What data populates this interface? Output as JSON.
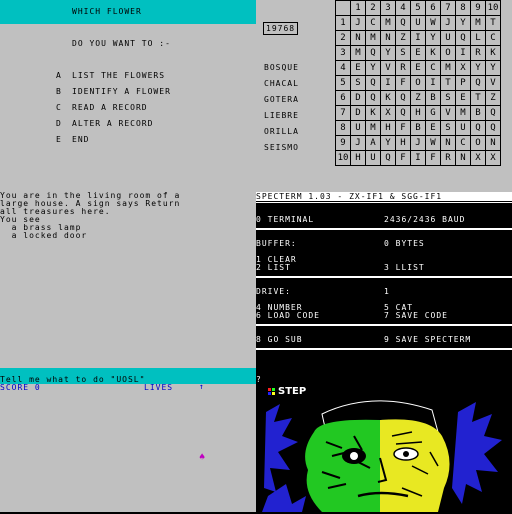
{
  "flower_menu": {
    "title": "WHICH FLOWER",
    "prompt": "DO YOU WANT TO :-",
    "options": [
      {
        "key": "A",
        "label": "LIST THE FLOWERS"
      },
      {
        "key": "B",
        "label": "IDENTIFY A FLOWER"
      },
      {
        "key": "C",
        "label": "READ A RECORD"
      },
      {
        "key": "D",
        "label": "ALTER A RECORD"
      },
      {
        "key": "E",
        "label": "END"
      }
    ]
  },
  "wordsearch": {
    "score": "19768",
    "words": [
      "BOSQUE",
      "CHACAL",
      "GOTERA",
      "LIEBRE",
      "ORILLA",
      "SEISMO"
    ],
    "col_headers": [
      "1",
      "2",
      "3",
      "4",
      "5",
      "6",
      "7",
      "8",
      "9",
      "10"
    ],
    "rows": [
      {
        "n": "1",
        "letters": [
          "J",
          "C",
          "M",
          "Q",
          "U",
          "W",
          "J",
          "Y",
          "M",
          "T"
        ]
      },
      {
        "n": "2",
        "letters": [
          "N",
          "M",
          "N",
          "Z",
          "I",
          "Y",
          "U",
          "Q",
          "L",
          "C"
        ]
      },
      {
        "n": "3",
        "letters": [
          "M",
          "Q",
          "Y",
          "S",
          "E",
          "K",
          "O",
          "I",
          "R",
          "K"
        ]
      },
      {
        "n": "4",
        "letters": [
          "E",
          "Y",
          "V",
          "R",
          "E",
          "C",
          "M",
          "X",
          "Y",
          "Y"
        ]
      },
      {
        "n": "5",
        "letters": [
          "S",
          "Q",
          "I",
          "F",
          "O",
          "I",
          "T",
          "P",
          "Q",
          "V"
        ]
      },
      {
        "n": "6",
        "letters": [
          "D",
          "Q",
          "K",
          "Q",
          "Z",
          "B",
          "S",
          "E",
          "T",
          "Z"
        ]
      },
      {
        "n": "7",
        "letters": [
          "D",
          "K",
          "X",
          "Q",
          "H",
          "G",
          "V",
          "M",
          "B",
          "Q"
        ]
      },
      {
        "n": "8",
        "letters": [
          "U",
          "M",
          "H",
          "F",
          "B",
          "E",
          "S",
          "U",
          "Q",
          "Q"
        ]
      },
      {
        "n": "9",
        "letters": [
          "J",
          "A",
          "Y",
          "H",
          "J",
          "W",
          "N",
          "C",
          "O",
          "N"
        ]
      },
      {
        "n": "10",
        "letters": [
          "H",
          "U",
          "Q",
          "F",
          "I",
          "F",
          "R",
          "N",
          "X",
          "X"
        ]
      }
    ]
  },
  "adventure": {
    "lines": [
      "You are in the living room of a",
      "large house. A sign says Return",
      "all treasures here.",
      "You see",
      "  a brass lamp",
      "  a locked door"
    ],
    "command_prompt": "Tell me what to do \"UOSL\"",
    "score_label": "SCORE 0",
    "lives_label": "LIVES",
    "lives_arrow": "↑",
    "player_glyph": "♠"
  },
  "specterm": {
    "header": "SPECTERM 1.03 - ZX-IF1 & SGG-IF1",
    "terminal": "0 TERMINAL",
    "baud": "2436/2436 BAUD",
    "buffer_label": "BUFFER:",
    "buffer_value": "0 BYTES",
    "opt1": "1 CLEAR",
    "opt2": "2 LIST",
    "opt3": "3 LLIST",
    "drive_label": "DRIVE:",
    "drive_value": "1",
    "opt4": "4 NUMBER",
    "opt5": "5 CAT",
    "opt6": "6 LOAD CODE",
    "opt7": "7 SAVE CODE",
    "opt8": "8 GO SUB",
    "opt9": "9 SAVE SPECTERM",
    "cursor": "?"
  },
  "step": {
    "logo": "STEP"
  }
}
